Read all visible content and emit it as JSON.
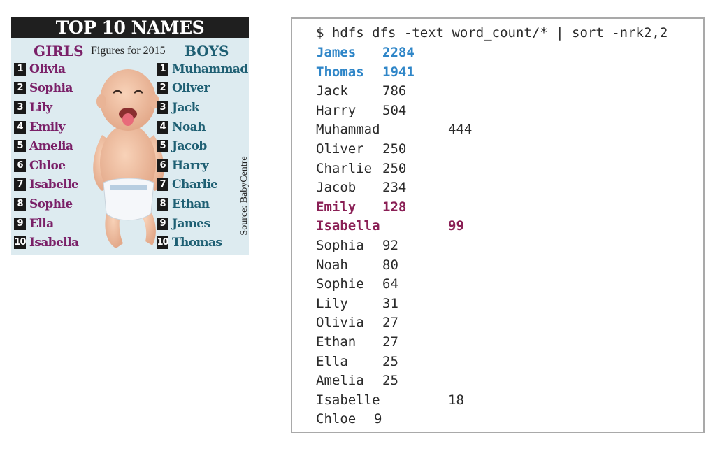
{
  "infographic": {
    "title": "TOP 10 NAMES",
    "girls_header": "GIRLS",
    "boys_header": "BOYS",
    "figures_note": "Figures for 2015",
    "source": "Source: BabyCentre",
    "girls": [
      {
        "rank": "1",
        "name": "Olivia"
      },
      {
        "rank": "2",
        "name": "Sophia"
      },
      {
        "rank": "3",
        "name": "Lily"
      },
      {
        "rank": "4",
        "name": "Emily"
      },
      {
        "rank": "5",
        "name": "Amelia"
      },
      {
        "rank": "6",
        "name": "Chloe"
      },
      {
        "rank": "7",
        "name": "Isabelle"
      },
      {
        "rank": "8",
        "name": "Sophie"
      },
      {
        "rank": "9",
        "name": "Ella"
      },
      {
        "rank": "10",
        "name": "Isabella"
      }
    ],
    "boys": [
      {
        "rank": "1",
        "name": "Muhammad"
      },
      {
        "rank": "2",
        "name": "Oliver"
      },
      {
        "rank": "3",
        "name": "Jack"
      },
      {
        "rank": "4",
        "name": "Noah"
      },
      {
        "rank": "5",
        "name": "Jacob"
      },
      {
        "rank": "6",
        "name": "Harry"
      },
      {
        "rank": "7",
        "name": "Charlie"
      },
      {
        "rank": "8",
        "name": "Ethan"
      },
      {
        "rank": "9",
        "name": "James"
      },
      {
        "rank": "10",
        "name": "Thomas"
      }
    ],
    "colors": {
      "girls": "#7a2068",
      "boys": "#1e5f73",
      "title_bg": "#1f1f1f",
      "panel_bg": "#ddebf0"
    }
  },
  "terminal": {
    "command": "$ hdfs dfs -text word_count/* | sort -nrk2,2",
    "rows": [
      {
        "name": "James",
        "count": "2284",
        "style": "blue",
        "gap": "wide"
      },
      {
        "name": "Thomas",
        "count": "1941",
        "style": "blue",
        "gap": "wide"
      },
      {
        "name": "Jack",
        "count": "786",
        "style": "plain",
        "gap": "wide"
      },
      {
        "name": "Harry",
        "count": "504",
        "style": "plain",
        "gap": "wide"
      },
      {
        "name": "Muhammad",
        "count": "444",
        "style": "plain",
        "gap": "tab"
      },
      {
        "name": "Oliver",
        "count": "250",
        "style": "plain",
        "gap": "narrow"
      },
      {
        "name": "Charlie",
        "count": "250",
        "style": "plain",
        "gap": "narrow"
      },
      {
        "name": "Jacob",
        "count": "234",
        "style": "plain",
        "gap": "narrow"
      },
      {
        "name": "Emily",
        "count": "128",
        "style": "purple",
        "gap": "narrow"
      },
      {
        "name": "Isabella",
        "count": "99",
        "style": "purple",
        "gap": "tab"
      },
      {
        "name": "Sophia",
        "count": "92",
        "style": "plain",
        "gap": "tight"
      },
      {
        "name": "Noah",
        "count": "80",
        "style": "plain",
        "gap": "tight"
      },
      {
        "name": "Sophie",
        "count": "64",
        "style": "plain",
        "gap": "tight"
      },
      {
        "name": "Lily",
        "count": "31",
        "style": "plain",
        "gap": "tight"
      },
      {
        "name": "Olivia",
        "count": "27",
        "style": "plain",
        "gap": "tight"
      },
      {
        "name": "Ethan",
        "count": "27",
        "style": "plain",
        "gap": "tight"
      },
      {
        "name": "Ella",
        "count": "25",
        "style": "plain",
        "gap": "tight"
      },
      {
        "name": "Amelia",
        "count": "25",
        "style": "plain",
        "gap": "tight"
      },
      {
        "name": "Isabelle",
        "count": "18",
        "style": "plain",
        "gap": "tab"
      },
      {
        "name": "Chloe",
        "count": "9",
        "style": "plain",
        "gap": "chloe"
      }
    ],
    "colors": {
      "blue": "#2f86c8",
      "purple": "#8a1f55",
      "text": "#2a2a2a",
      "border": "#a9a9a9"
    }
  }
}
